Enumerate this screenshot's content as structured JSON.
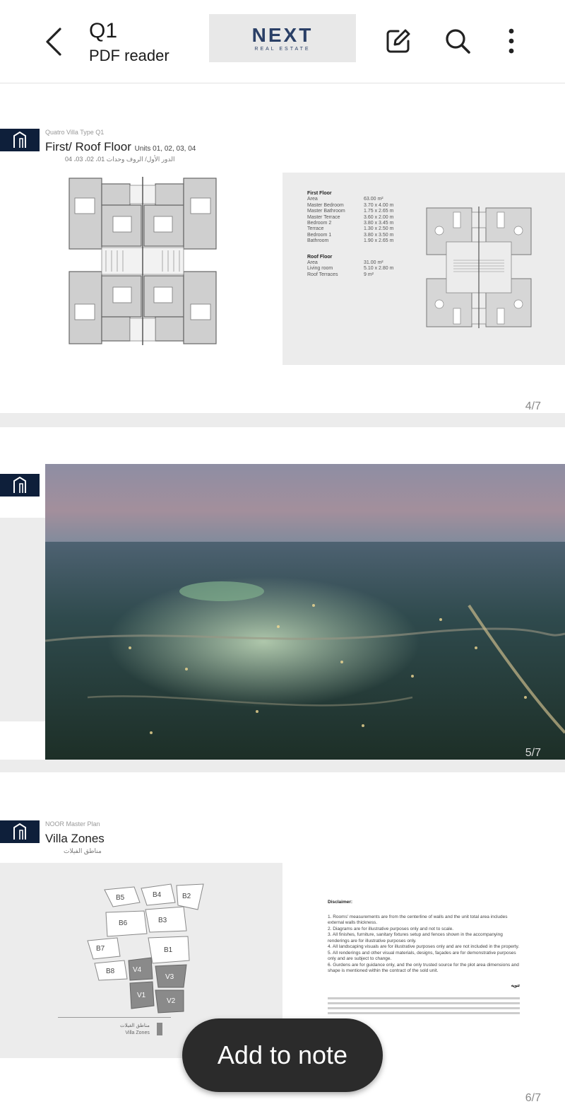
{
  "header": {
    "title": "Q1",
    "subtitle": "PDF reader",
    "logo_word": "NEXT",
    "logo_tagline": "REAL ESTATE",
    "icons": [
      "back-arrow-icon",
      "edit-note-icon",
      "search-icon",
      "more-vert-icon"
    ]
  },
  "pages": [
    {
      "number": "4/7",
      "section_small": "Quatro Villa Type Q1",
      "title": "First/ Roof Floor",
      "title_units": "Units 01, 02, 03, 04",
      "title_arabic": "الدور الأول/ الروف وحدات 01، 02، 03، 04",
      "specs": {
        "first_floor_heading": "First Floor",
        "first_floor": [
          {
            "label": "Area",
            "value": "63.00 m²"
          },
          {
            "label": "Master Bedroom",
            "value": "3.70 x 4.00 m"
          },
          {
            "label": "Master Bathroom",
            "value": "1.75 x 2.65 m"
          },
          {
            "label": "Master Terrace",
            "value": "3.60 x 2.00 m"
          },
          {
            "label": "Bedroom 2",
            "value": "3.80 x 3.45 m"
          },
          {
            "label": "Terrace",
            "value": "1.30 x 2.50 m"
          },
          {
            "label": "Bedroom 1",
            "value": "3.80 x 3.50 m"
          },
          {
            "label": "Bathroom",
            "value": "1.90 x 2.65 m"
          }
        ],
        "roof_floor_heading": "Roof Floor",
        "roof_floor": [
          {
            "label": "Area",
            "value": "31.00 m²"
          },
          {
            "label": "Living room",
            "value": "5.10 x 2.80 m"
          },
          {
            "label": "Roof Terraces",
            "value": "9 m²"
          }
        ]
      }
    },
    {
      "number": "5/7"
    },
    {
      "number": "6/7",
      "section_small": "NOOR Master Plan",
      "title": "Villa Zones",
      "title_arabic": "مناطق الفيلات",
      "zones": [
        "B5",
        "B4",
        "B2",
        "B3",
        "B6",
        "B7",
        "B1",
        "B8",
        "V4",
        "V3",
        "V1",
        "V2"
      ],
      "legend_ar": "مناطق الفيلات",
      "legend_en": "Villa Zones",
      "disclaimer_heading": "Disclaimer:",
      "disclaimer": [
        "1. Rooms' measurements are from the centerline of walls and the unit total area includes external walls thickness.",
        "2. Diagrams are for illustrative purposes only and not to scale.",
        "3. All finishes, furniture, sanitary fixtures setup and fences shown in the accompanying renderings are for illustrative purposes only.",
        "4. All landscaping visuals are for illustrative purposes only and are not included in the property.",
        "5. All renderings and other visual materials, designs, façades are for demonstrative purposes only and are subject to change.",
        "6. Gurdens are for guidance only, and the only trusted source for the plot area dimensions and shape is mentioned within the contract of the sold unit."
      ],
      "arabic_heading": "تنويه"
    }
  ],
  "fab_label": "Add to note"
}
